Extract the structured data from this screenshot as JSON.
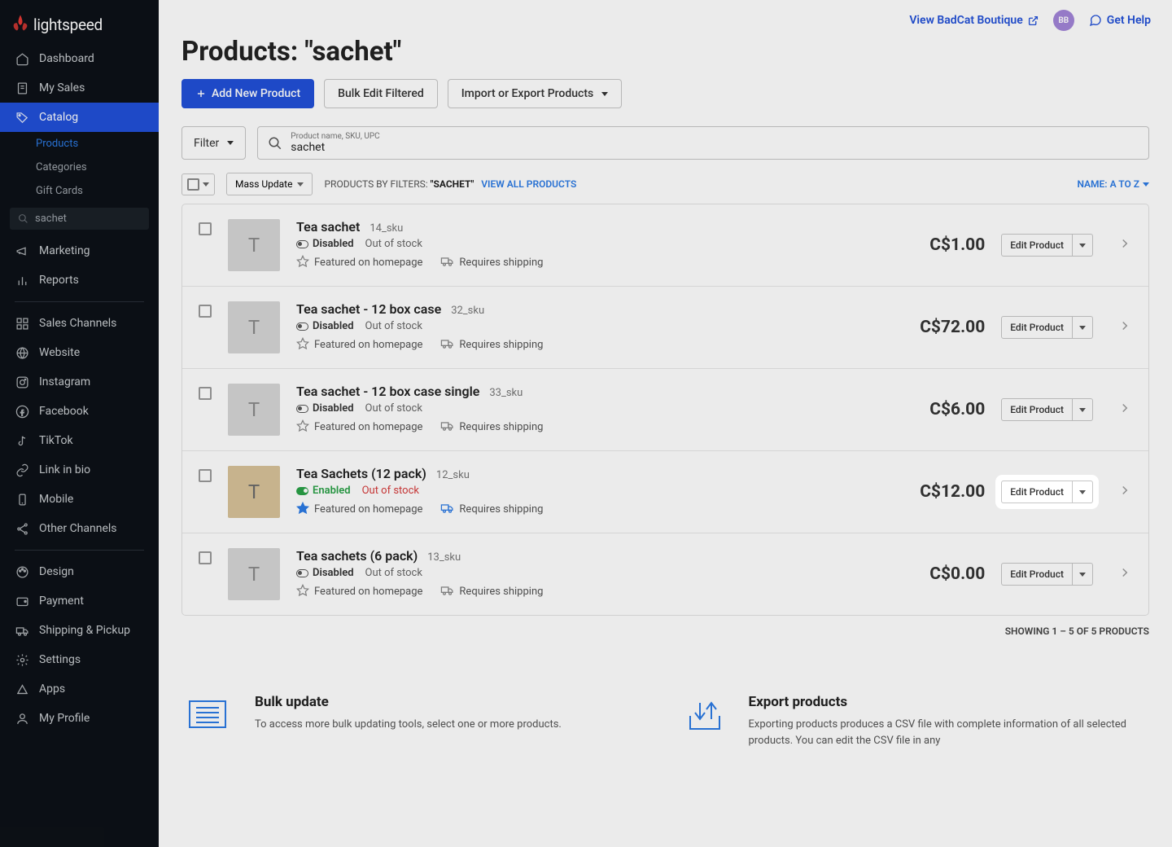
{
  "brand": "lightspeed",
  "sidebar": {
    "items": [
      {
        "label": "Dashboard",
        "icon": "home"
      },
      {
        "label": "My Sales",
        "icon": "receipt"
      },
      {
        "label": "Catalog",
        "icon": "tag",
        "active": true
      },
      {
        "label": "Marketing",
        "icon": "megaphone"
      },
      {
        "label": "Reports",
        "icon": "chart"
      },
      {
        "label": "Sales Channels",
        "icon": "grid"
      },
      {
        "label": "Website",
        "icon": "globe"
      },
      {
        "label": "Instagram",
        "icon": "instagram"
      },
      {
        "label": "Facebook",
        "icon": "facebook"
      },
      {
        "label": "TikTok",
        "icon": "tiktok"
      },
      {
        "label": "Link in bio",
        "icon": "link"
      },
      {
        "label": "Mobile",
        "icon": "mobile"
      },
      {
        "label": "Other Channels",
        "icon": "share"
      },
      {
        "label": "Design",
        "icon": "palette"
      },
      {
        "label": "Payment",
        "icon": "wallet"
      },
      {
        "label": "Shipping & Pickup",
        "icon": "truck"
      },
      {
        "label": "Settings",
        "icon": "gear"
      },
      {
        "label": "Apps",
        "icon": "apps"
      },
      {
        "label": "My Profile",
        "icon": "user"
      }
    ],
    "sub": [
      {
        "label": "Products",
        "active": true
      },
      {
        "label": "Categories"
      },
      {
        "label": "Gift Cards"
      }
    ],
    "search": "sachet"
  },
  "topbar": {
    "store_link": "View BadCat Boutique",
    "avatar": "BB",
    "help": "Get Help"
  },
  "page": {
    "title": "Products: \"sachet\"",
    "add_btn": "Add New Product",
    "bulk_btn": "Bulk Edit Filtered",
    "import_btn": "Import or Export Products",
    "filter_btn": "Filter",
    "search_hint": "Product name, SKU, UPC",
    "search_value": "sachet",
    "mass_btn": "Mass Update",
    "filters_label": "PRODUCTS BY FILTERS:",
    "filters_value": "\"SACHET\"",
    "view_all": "VIEW ALL PRODUCTS",
    "sort": "NAME: A TO Z",
    "edit_btn": "Edit Product",
    "showing": "SHOWING 1 – 5 OF 5 PRODUCTS"
  },
  "labels": {
    "disabled": "Disabled",
    "enabled": "Enabled",
    "out_of_stock": "Out of stock",
    "featured": "Featured on homepage",
    "shipping": "Requires shipping"
  },
  "products": [
    {
      "name": "Tea sachet",
      "sku": "14_sku",
      "enabled": false,
      "stock_red": false,
      "price": "C$1.00",
      "featured": false,
      "ship_active": false,
      "tan": false
    },
    {
      "name": "Tea sachet - 12 box case",
      "sku": "32_sku",
      "enabled": false,
      "stock_red": false,
      "price": "C$72.00",
      "featured": false,
      "ship_active": false,
      "tan": false
    },
    {
      "name": "Tea sachet - 12 box case single",
      "sku": "33_sku",
      "enabled": false,
      "stock_red": false,
      "price": "C$6.00",
      "featured": false,
      "ship_active": false,
      "tan": false
    },
    {
      "name": "Tea Sachets (12 pack)",
      "sku": "12_sku",
      "enabled": true,
      "stock_red": true,
      "price": "C$12.00",
      "featured": true,
      "ship_active": true,
      "tan": true,
      "highlight": true
    },
    {
      "name": "Tea sachets (6 pack)",
      "sku": "13_sku",
      "enabled": false,
      "stock_red": false,
      "price": "C$0.00",
      "featured": false,
      "ship_active": false,
      "tan": false
    }
  ],
  "promos": {
    "bulk": {
      "title": "Bulk update",
      "desc": "To access more bulk updating tools, select one or more products."
    },
    "export": {
      "title": "Export products",
      "desc": "Exporting products produces a CSV file with complete information of all selected products. You can edit the CSV file in any"
    }
  }
}
